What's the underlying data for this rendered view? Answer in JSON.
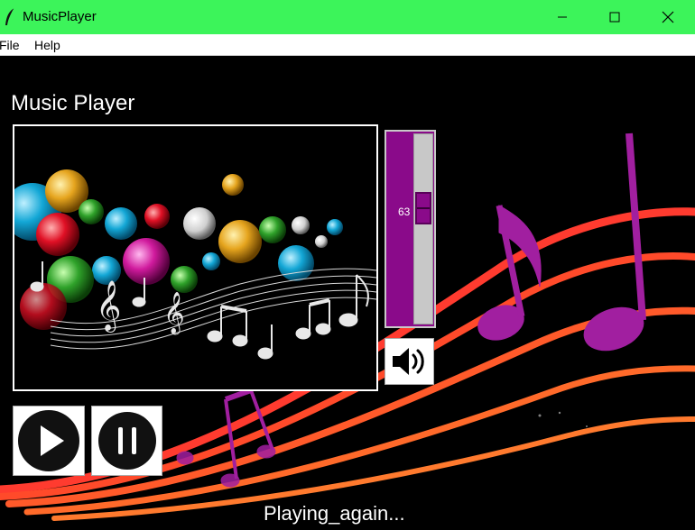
{
  "window": {
    "title": "MusicPlayer",
    "icon": "feather-icon"
  },
  "menu": {
    "items": [
      {
        "label": "File"
      },
      {
        "label": "Help"
      }
    ]
  },
  "main": {
    "heading": "Music Player",
    "volume": {
      "value": "63",
      "level_fraction": 0.37
    },
    "status": "Playing_again...",
    "icons": {
      "mute": "speaker-icon",
      "play": "play-icon",
      "pause": "pause-icon"
    }
  },
  "colors": {
    "titlebar": "#3cf45a",
    "accent": "#8a0a8a",
    "background": "#000000"
  }
}
